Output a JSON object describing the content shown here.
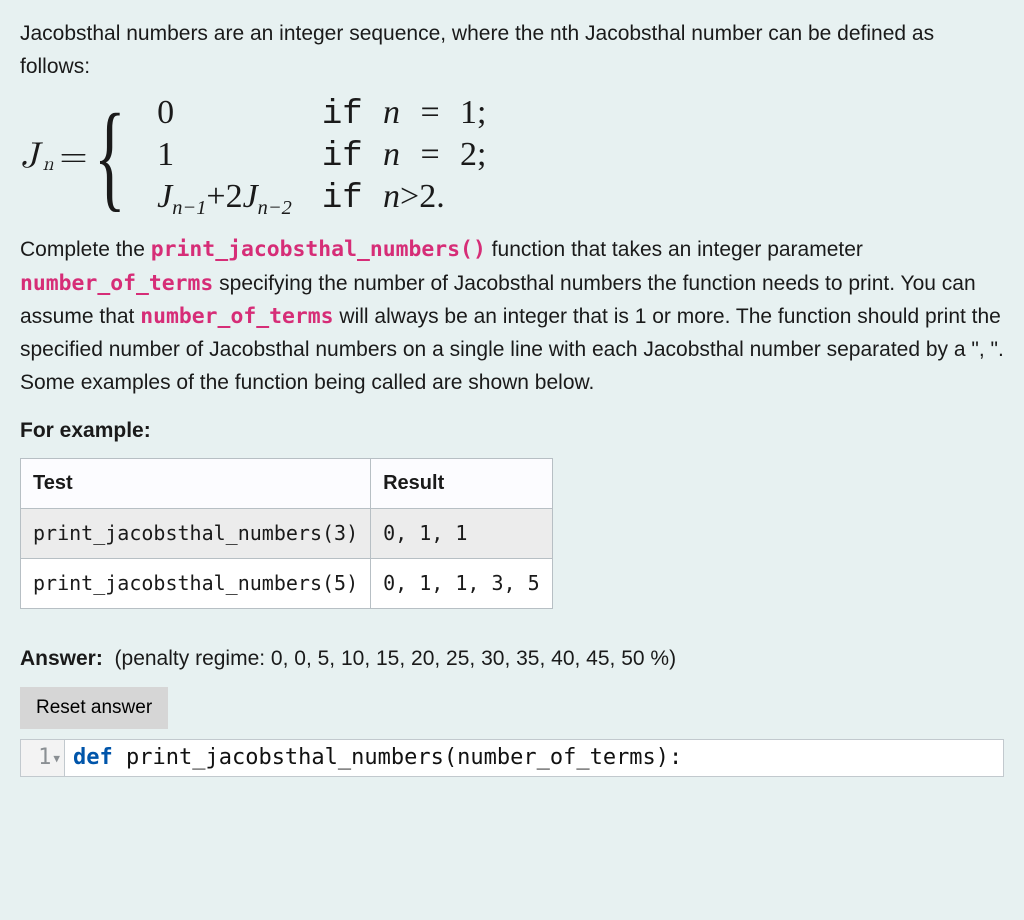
{
  "intro": "Jacobsthal numbers are an integer sequence, where the nth Jacobsthal number can be defined as follows:",
  "formula": {
    "lhs_symbol": "J",
    "lhs_sub": "n",
    "eq": "=",
    "cases": [
      {
        "value": "0",
        "cond_prefix": "if ",
        "cond_var": "n",
        "cond_op": "=",
        "cond_rhs": "1;"
      },
      {
        "value": "1",
        "cond_prefix": "if ",
        "cond_var": "n",
        "cond_op": "=",
        "cond_rhs": "2;"
      },
      {
        "value_is_expr": true,
        "expr": {
          "t1": "J",
          "s1": "n−1",
          "plus": "+2",
          "t2": "J",
          "s2": "n−2"
        },
        "cond_prefix": "if ",
        "cond_var": "n",
        "cond_op": ">",
        "cond_rhs": "2."
      }
    ]
  },
  "desc": {
    "p1a": "Complete the ",
    "fn": "print_jacobsthal_numbers()",
    "p1b": " function that takes an integer parameter ",
    "param": "number_of_terms",
    "p1c": " specifying the number of Jacobsthal numbers the function needs to print. You can assume that ",
    "param2": "number_of_terms",
    "p1d": " will always be an integer that is 1 or more. The function should print the specified number of Jacobsthal numbers on a single line with each Jacobsthal number separated by a \", \". Some examples of the function being called are shown below."
  },
  "for_example": "For example:",
  "table": {
    "headers": [
      "Test",
      "Result"
    ],
    "rows": [
      {
        "test": "print_jacobsthal_numbers(3)",
        "result": "0, 1, 1"
      },
      {
        "test": "print_jacobsthal_numbers(5)",
        "result": "0, 1, 1, 3, 5"
      }
    ]
  },
  "answer": {
    "label": "Answer:",
    "penalty": "(penalty regime: 0, 0, 5, 10, 15, 20, 25, 30, 35, 40, 45, 50 %)"
  },
  "reset_label": "Reset answer",
  "editor": {
    "line_no": "1",
    "kw": "def",
    "rest": " print_jacobsthal_numbers(number_of_terms):"
  }
}
